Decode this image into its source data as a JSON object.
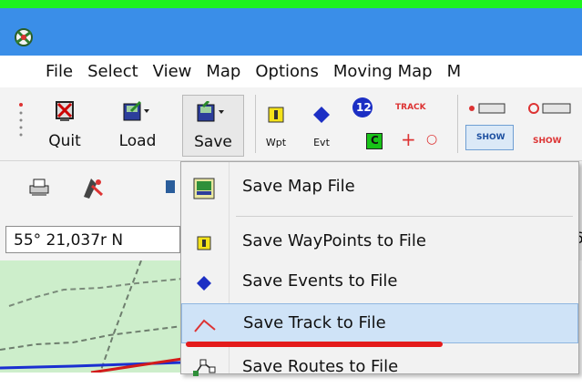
{
  "menubar": {
    "items": [
      "File",
      "Select",
      "View",
      "Map",
      "Options",
      "Moving Map",
      "M"
    ]
  },
  "toolbar": {
    "quit_label": "Quit",
    "load_label": "Load",
    "save_label": "Save",
    "wpt_label": "Wpt",
    "evt_label": "Evt",
    "badge_12": "12",
    "track_label": "TRACK",
    "show_label": "SHOW",
    "c_label": "C"
  },
  "coordinates": {
    "latitude": "55° 21,037r N",
    "right_fragment": "6"
  },
  "save_menu": {
    "items": [
      {
        "label": "Save Map File",
        "icon": "map-file-icon"
      },
      {
        "label": "Save WayPoints to File",
        "icon": "waypoint-icon"
      },
      {
        "label": "Save Events to File",
        "icon": "event-diamond-icon"
      },
      {
        "label": "Save Track to File",
        "icon": "track-icon",
        "highlighted": true
      },
      {
        "label": "Save Routes to File",
        "icon": "route-icon"
      }
    ]
  },
  "colors": {
    "titlebar": "#3a8ee8",
    "highlight": "#cfe3f7",
    "annotation_red": "#e41b1b",
    "top_strip": "#1ef11e"
  }
}
